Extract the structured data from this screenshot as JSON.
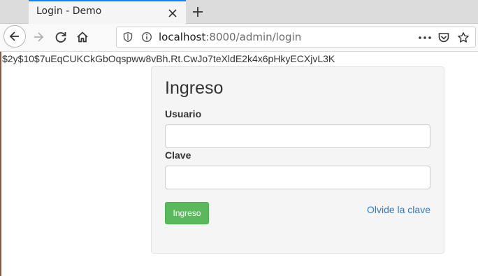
{
  "browser": {
    "tab_title": "Login - Demo",
    "url_host": "localhost",
    "url_rest": ":8000/admin/login",
    "icons": [
      "back-arrow-icon",
      "forward-arrow-icon",
      "reload-icon",
      "home-icon",
      "tracking-shield-icon",
      "info-icon",
      "more-dots-icon",
      "pocket-icon",
      "bookmark-star-icon",
      "close-icon",
      "plus-icon"
    ]
  },
  "page": {
    "hash_text": "$2y$10$7uEqCUKCkGbOqspww8vBh.Rt.CwJo7teXldE2k4x6pHkyECXjvL3K"
  },
  "login": {
    "title": "Ingreso",
    "username_label": "Usuario",
    "username_value": "",
    "password_label": "Clave",
    "password_value": "",
    "submit_label": "Ingreso",
    "forgot_label": "Olvide la clave"
  },
  "colors": {
    "accent_tab": "#0a84ff",
    "button_green": "#5cb85c",
    "link_blue": "#337ab7",
    "panel_bg": "#f5f5f5"
  }
}
